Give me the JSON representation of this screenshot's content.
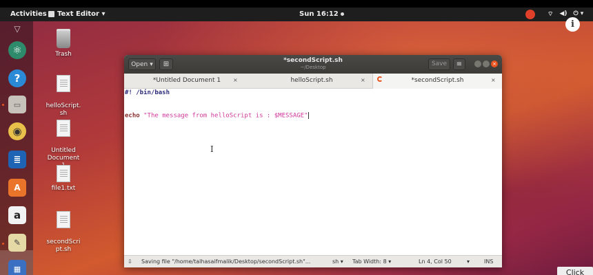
{
  "topbar": {
    "activities": "Activities",
    "app_menu": "Text Editor ▾",
    "clock": "Sun 16:12"
  },
  "dock": {
    "items": [
      "ubuntu-logo",
      "help",
      "files",
      "speaker",
      "writer",
      "software-center",
      "amazon",
      "text-editor",
      "impress"
    ]
  },
  "desktop_icons": [
    {
      "label": "Trash"
    },
    {
      "label": "helloScript.\nsh"
    },
    {
      "label": "Untitled\nDocument\n1"
    },
    {
      "label": "file1.txt"
    },
    {
      "label": "secondScri\npt.sh"
    }
  ],
  "window": {
    "open_label": "Open",
    "title": "*secondScript.sh",
    "subtitle": "~/Desktop",
    "save_label": "Save",
    "tabs": [
      {
        "label": "*Untitled Document 1"
      },
      {
        "label": "helloScript.sh"
      },
      {
        "label": "*secondScript.sh"
      }
    ],
    "code": {
      "line1": "#! /bin/bash",
      "line4_kw": "echo",
      "line4_str": " \"The message from helloScript is : $MESSAGE\""
    },
    "status": {
      "saving": "Saving file \"/home/talhasaifmalik/Desktop/secondScript.sh\"...",
      "lang": "sh ▾",
      "tab_width": "Tab Width: 8 ▾",
      "position": "Ln 4, Col 50",
      "mode": "INS"
    }
  },
  "overlay": {
    "click_label": "Click"
  },
  "colors": {
    "ubuntu_orange": "#e95420",
    "titlebar": "#3c3b37"
  }
}
